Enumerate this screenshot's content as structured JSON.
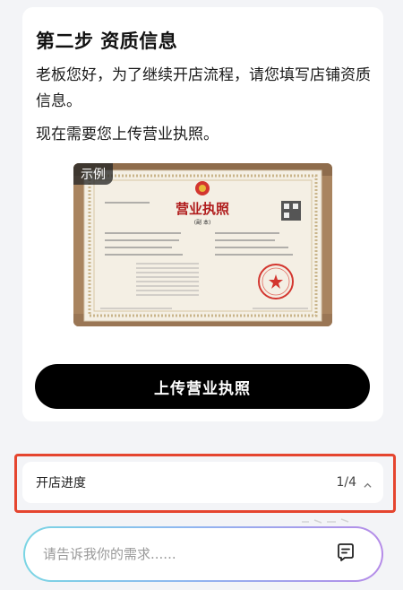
{
  "step": {
    "title": "第二步 资质信息",
    "intro": "老板您好，为了继续开店流程，请您填写店铺资质信息。",
    "need": "现在需要您上传营业执照。"
  },
  "example": {
    "tag": "示例",
    "license_title": "营业执照",
    "license_sub": "(副 本)"
  },
  "upload_button": "上传营业执照",
  "progress": {
    "label": "开店进度",
    "value": "1/4"
  },
  "chat": {
    "placeholder": "请告诉我你的需求......"
  },
  "colors": {
    "highlight": "#e5452f",
    "button": "#000000"
  },
  "icons": [
    "chevron-up-icon",
    "chat-send-icon"
  ]
}
